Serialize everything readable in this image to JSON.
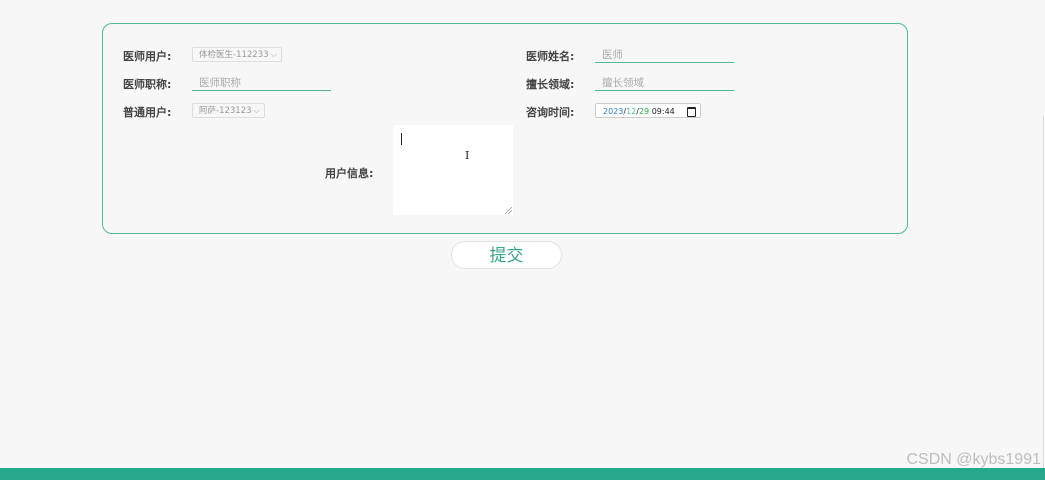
{
  "form": {
    "doctor_user": {
      "label": "医师用户:",
      "value": "体检医生-112233"
    },
    "doctor_title": {
      "label": "医师职称:",
      "placeholder": "医师职称"
    },
    "normal_user": {
      "label": "普通用户:",
      "value": "阿萨-123123"
    },
    "doctor_name": {
      "label": "医师姓名:",
      "placeholder": "医师"
    },
    "specialty": {
      "label": "擅长领域:",
      "placeholder": "擅长领域"
    },
    "consult_time": {
      "label": "咨询时间:",
      "year": "2023",
      "month": "12",
      "day": "29",
      "time": "09:44"
    },
    "user_info": {
      "label": "用户信息:",
      "value": ""
    }
  },
  "submit_label": "提交",
  "watermark": "CSDN @kybs1991",
  "colors": {
    "accent": "#52b99a",
    "footer": "#25a88c",
    "background": "#f7f7f7"
  }
}
